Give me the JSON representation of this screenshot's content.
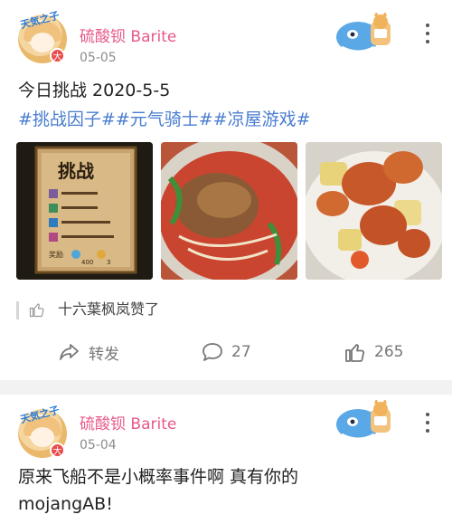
{
  "post1": {
    "username": "硫酸钡 Barite",
    "date": "05-05",
    "text": "今日挑战 2020-5-5",
    "tags": "#挑战因子##元气骑士##凉屋游戏#",
    "images": [
      {
        "label_title": "挑战",
        "label_reward": "奖励",
        "label_count_a": "400",
        "label_count_b": "3"
      },
      {},
      {}
    ],
    "liked_by": "十六葉枫岚赞了",
    "actions": {
      "repost": "转发",
      "comments": "27",
      "likes": "265"
    }
  },
  "post2": {
    "username": "硫酸钡 Barite",
    "date": "05-04",
    "text_line1": "原来飞船不是小概率事件啊 真有你的",
    "text_line2": "mojangAB!"
  },
  "avatar": {
    "badge": "天気之子",
    "vip": "大"
  },
  "colors": {
    "username": "#e9588a",
    "tag": "#4a7dd0",
    "meta": "#8c8c8c"
  },
  "icons": [
    "more-vert-icon",
    "thumb-up-icon",
    "repost-icon",
    "comment-icon",
    "like-icon"
  ]
}
